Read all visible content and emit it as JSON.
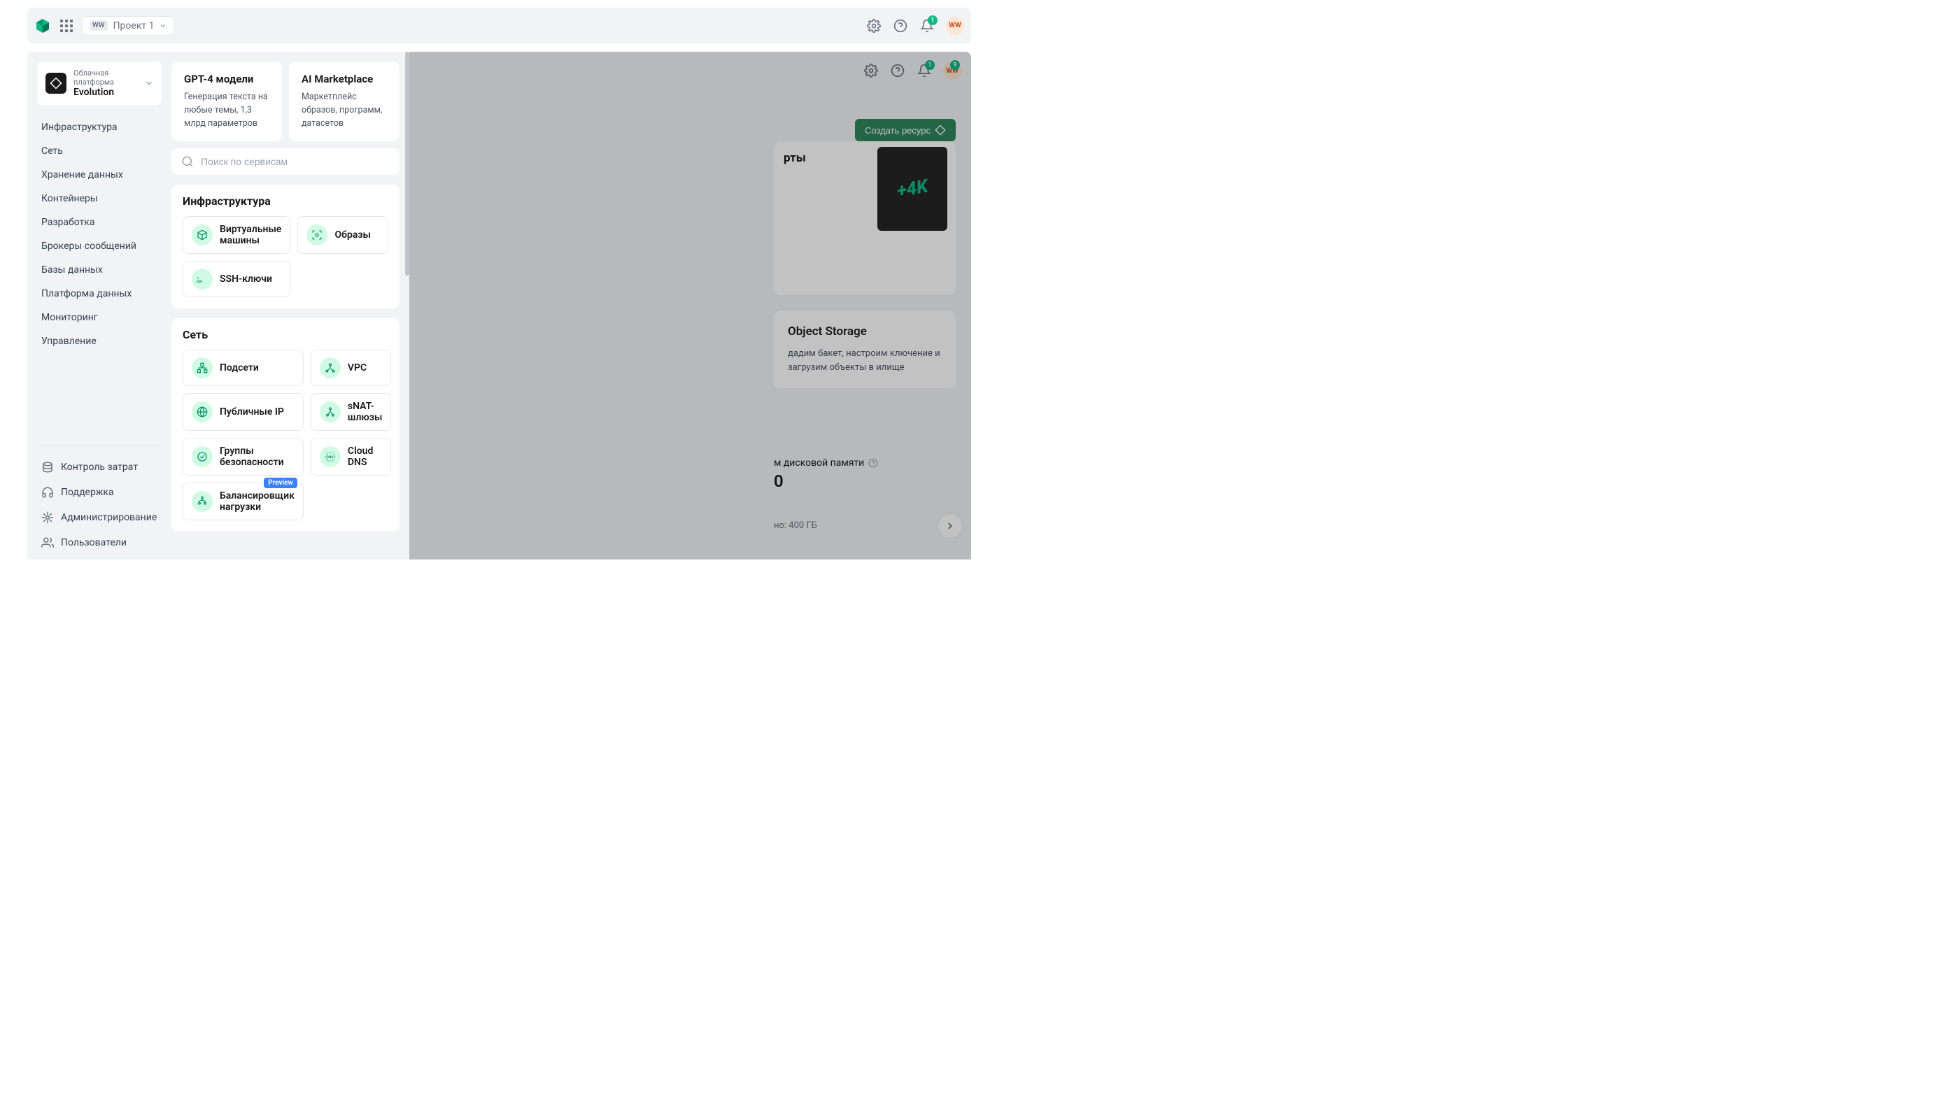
{
  "header": {
    "project_badge": "WW",
    "project_name": "Проект 1",
    "notif_count": "1",
    "avatar": "WW"
  },
  "bg": {
    "topbar_notif": "1",
    "topbar_badge2": "9",
    "topbar_avatar": "WW",
    "create_button": "Создать ресурс",
    "promo_banner_text": "рты",
    "card2_title": "Object Storage",
    "card2_desc": "дадим бакет, настроим ключение и загрузим объекты в илище",
    "disk_label": "м дисковой памяти",
    "disk_value": "0",
    "disk_avail": "но: 400 ГБ"
  },
  "sidebar": {
    "platform_sub": "Облачная платформа",
    "platform_name": "Evolution",
    "nav": [
      "Инфраструктура",
      "Сеть",
      "Хранение данных",
      "Контейнеры",
      "Разработка",
      "Брокеры сообщений",
      "Базы данных",
      "Платформа данных",
      "Мониторинг",
      "Управление"
    ],
    "bottom": {
      "costs": "Контроль затрат",
      "support": "Поддержка",
      "admin": "Администрирование",
      "users": "Пользователи"
    }
  },
  "main": {
    "promos": [
      {
        "title": "GPT-4 модели",
        "desc": "Генерация текста на любые темы, 1,3 млрд параметров"
      },
      {
        "title": "AI Marketplace",
        "desc": "Маркетплейс образов, программ, датасетов"
      }
    ],
    "search_placeholder": "Поиск по сервисам",
    "sections": {
      "infra": {
        "title": "Инфраструктура",
        "items": [
          "Виртуальные машины",
          "Образы",
          "SSH-ключи"
        ]
      },
      "net": {
        "title": "Сеть",
        "items": [
          "Подсети",
          "VPC",
          "Публичные IP",
          "sNAT-шлюзы",
          "Группы безопасности",
          "Cloud DNS",
          "Балансировщик нагрузки"
        ],
        "preview_tag": "Preview"
      }
    }
  }
}
